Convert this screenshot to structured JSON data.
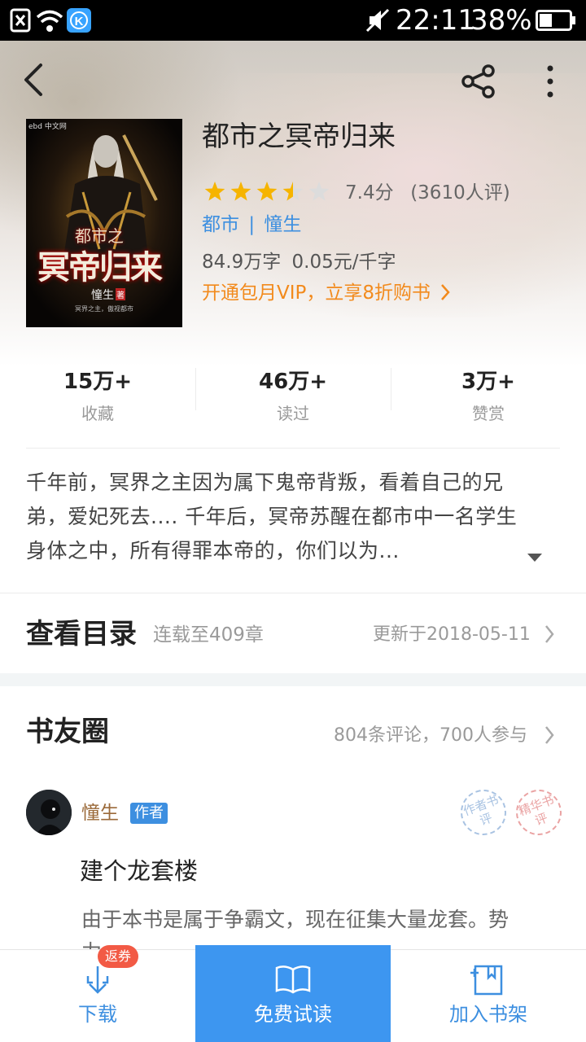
{
  "status_bar": {
    "time": "22:11",
    "battery_percent": "38%",
    "icons": [
      "sim-x-icon",
      "wifi-icon",
      "k-app-icon",
      "mute-icon",
      "battery-icon"
    ]
  },
  "header": {
    "back_icon": "back-arrow-icon",
    "share_icon": "share-icon",
    "more_icon": "more-vertical-icon"
  },
  "book": {
    "title": "都市之冥帝归来",
    "rating": 7.4,
    "rating_max": 10,
    "stars_filled": 3.5,
    "rating_score_text": "7.4分",
    "rating_count_text": "(3610人评)",
    "category": "都市",
    "separator": "|",
    "author": "憧生",
    "word_count_text": "84.9万字",
    "price_text": "0.05元/千字",
    "vip_promo": "开通包月VIP，立享8折购书",
    "cover": {
      "publisher_mark": "ebd 中文网",
      "title_line1": "都市之",
      "title_line2": "冥帝归来",
      "author": "憧生",
      "author_suffix": "著",
      "tagline": "冥界之主，傲视都市"
    }
  },
  "stats": [
    {
      "value": "15万+",
      "label": "收藏"
    },
    {
      "value": "46万+",
      "label": "读过"
    },
    {
      "value": "3万+",
      "label": "赞赏"
    }
  ],
  "description": {
    "line1": "千年前，冥界之主因为属下鬼帝背叛，看着自己的兄",
    "line2": "弟，爱妃死去.... 千年后，冥帝苏醒在都市中一名学生",
    "line3": "身体之中，所有得罪本帝的，你们以为...",
    "expand_icon": "triangle-down-icon"
  },
  "catalog": {
    "title": "查看目录",
    "status": "连载至409章",
    "updated": "更新于2018-05-11"
  },
  "circle": {
    "title": "书友圈",
    "summary": "804条评论，700人参与",
    "post": {
      "username": "憧生",
      "badge": "作者",
      "stamp1": "作者书评",
      "stamp2": "精华书评",
      "post_title": "建个龙套楼",
      "body_line1": "由于本书是属于争霸文，现在征集大量龙套。势",
      "body_line2": "力"
    }
  },
  "bottom_bar": {
    "download_label": "下载",
    "download_badge": "返券",
    "read_label": "免费试读",
    "add_label": "加入书架"
  },
  "colors": {
    "accent": "#3d8fe0",
    "orange": "#f28a1c",
    "star": "#f6b400",
    "badge_red": "#f25a45"
  }
}
